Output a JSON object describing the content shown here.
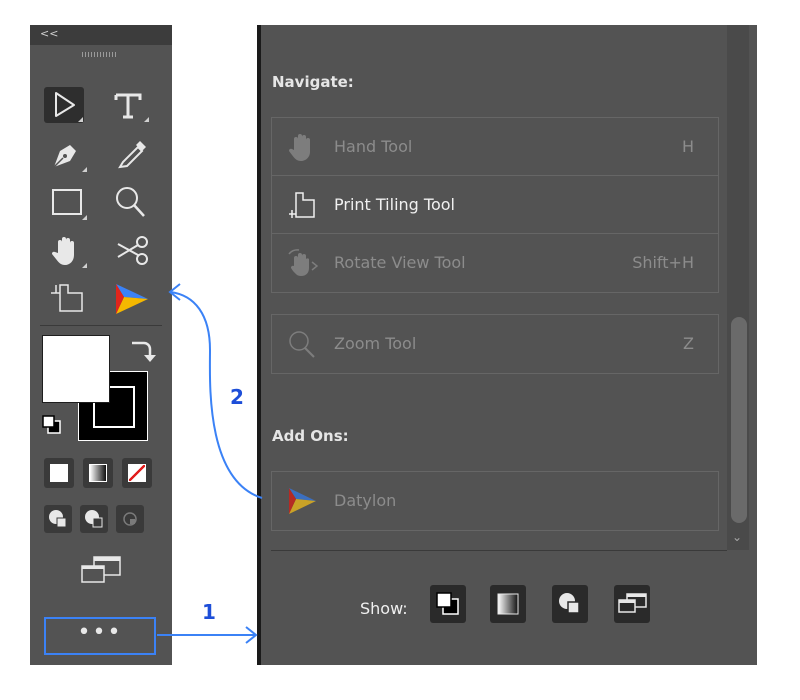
{
  "toolbar": {
    "collapse_label": "<<",
    "tools": [
      {
        "name": "selection-tool",
        "icon": "arrow-pointer-icon",
        "active": true
      },
      {
        "name": "type-tool",
        "icon": "type-t-icon"
      },
      {
        "name": "pen-tool",
        "icon": "pen-nib-icon"
      },
      {
        "name": "eyedropper-tool",
        "icon": "eyedropper-icon"
      },
      {
        "name": "rectangle-tool",
        "icon": "rectangle-icon"
      },
      {
        "name": "zoom-tool",
        "icon": "magnifier-icon"
      },
      {
        "name": "hand-tool",
        "icon": "hand-icon"
      },
      {
        "name": "scissors-tool",
        "icon": "scissors-icon"
      },
      {
        "name": "print-tiling-tool",
        "icon": "print-tiling-icon"
      },
      {
        "name": "datylon-tool",
        "icon": "datylon-logo-icon"
      }
    ],
    "fill_color": "#ffffff",
    "stroke_color": "#000000",
    "more_label": "•••"
  },
  "panel": {
    "navigate_title": "Navigate:",
    "navigate_items": [
      {
        "label": "Hand Tool",
        "shortcut": "H",
        "icon": "hand-icon",
        "enabled": false
      },
      {
        "label": "Print Tiling Tool",
        "shortcut": "",
        "icon": "print-tiling-icon",
        "enabled": true
      },
      {
        "label": "Rotate View Tool",
        "shortcut": "Shift+H",
        "icon": "rotate-view-icon",
        "enabled": false
      }
    ],
    "zoom_item": {
      "label": "Zoom Tool",
      "shortcut": "Z",
      "icon": "magnifier-icon",
      "enabled": false
    },
    "addons_title": "Add Ons:",
    "addon_items": [
      {
        "label": "Datylon",
        "icon": "datylon-logo-icon",
        "enabled": false
      }
    ],
    "show_label": "Show:"
  },
  "annotations": {
    "step1": "1",
    "step2": "2",
    "color": "#3b82f6"
  }
}
